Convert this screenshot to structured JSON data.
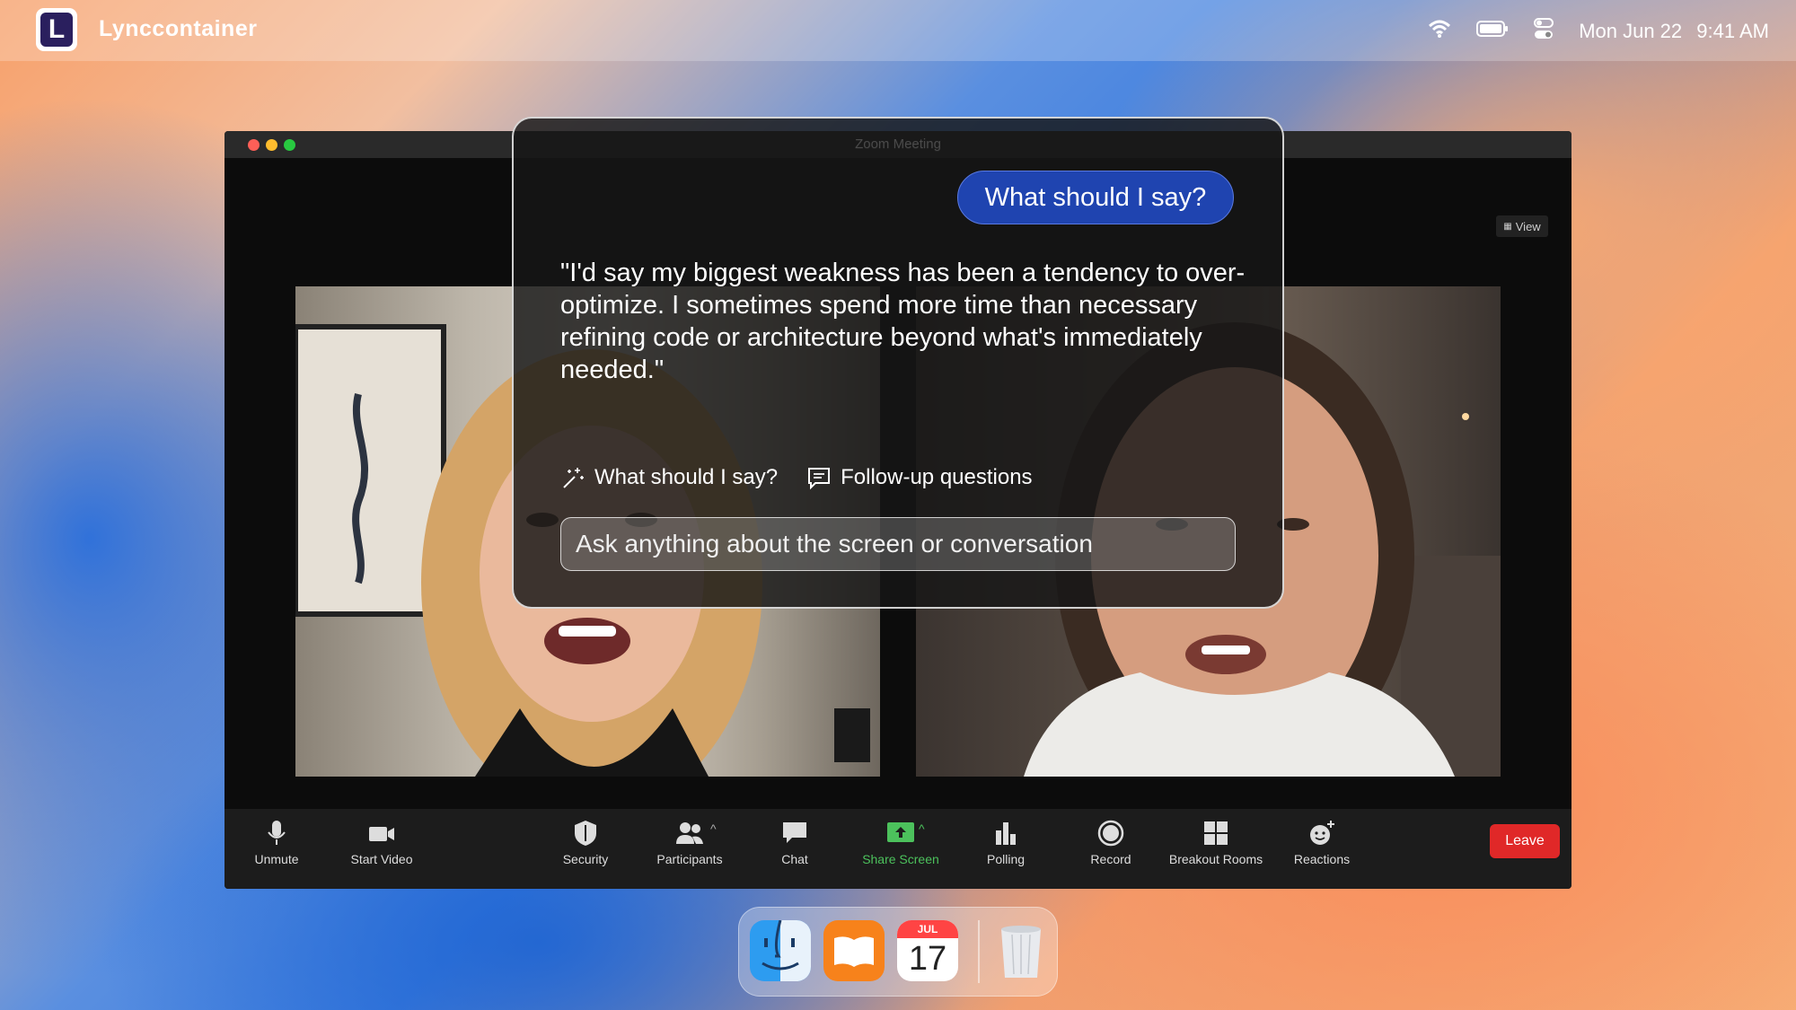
{
  "menubar": {
    "app_logo_letter": "L",
    "app_name": "Lynccontainer",
    "date": "Mon Jun 22",
    "time": "9:41 AM",
    "icons": [
      "wifi-icon",
      "battery-icon",
      "control-center-icon"
    ]
  },
  "zoom": {
    "window_title": "Zoom Meeting",
    "view_label": "View",
    "traffic_colors": [
      "#ff5f57",
      "#febc2e",
      "#28c840"
    ],
    "toolbar": {
      "unmute": "Unmute",
      "start_video": "Start Video",
      "security": "Security",
      "participants": "Participants",
      "chat": "Chat",
      "share_screen": "Share Screen",
      "polling": "Polling",
      "record": "Record",
      "breakout_rooms": "Breakout Rooms",
      "reactions": "Reactions",
      "leave": "Leave"
    },
    "colors": {
      "share_green": "#4cc15c",
      "leave_red": "#e02828"
    }
  },
  "overlay": {
    "question_chip": "What should I say?",
    "answer": "\"I'd say my biggest weakness has been a tendency to over-optimize. I sometimes spend more time than necessary refining code or architecture beyond what's immediately needed.\"",
    "actions": {
      "what_to_say": "What should I say?",
      "follow_up": "Follow-up questions"
    },
    "input_placeholder": "Ask anything about the screen or conversation",
    "colors": {
      "chip_blue": "#1f44b0"
    }
  },
  "dock": {
    "apps": [
      "finder-icon",
      "books-icon",
      "calendar-icon",
      "trash-icon"
    ],
    "calendar_month": "JUL",
    "calendar_day": "17"
  }
}
